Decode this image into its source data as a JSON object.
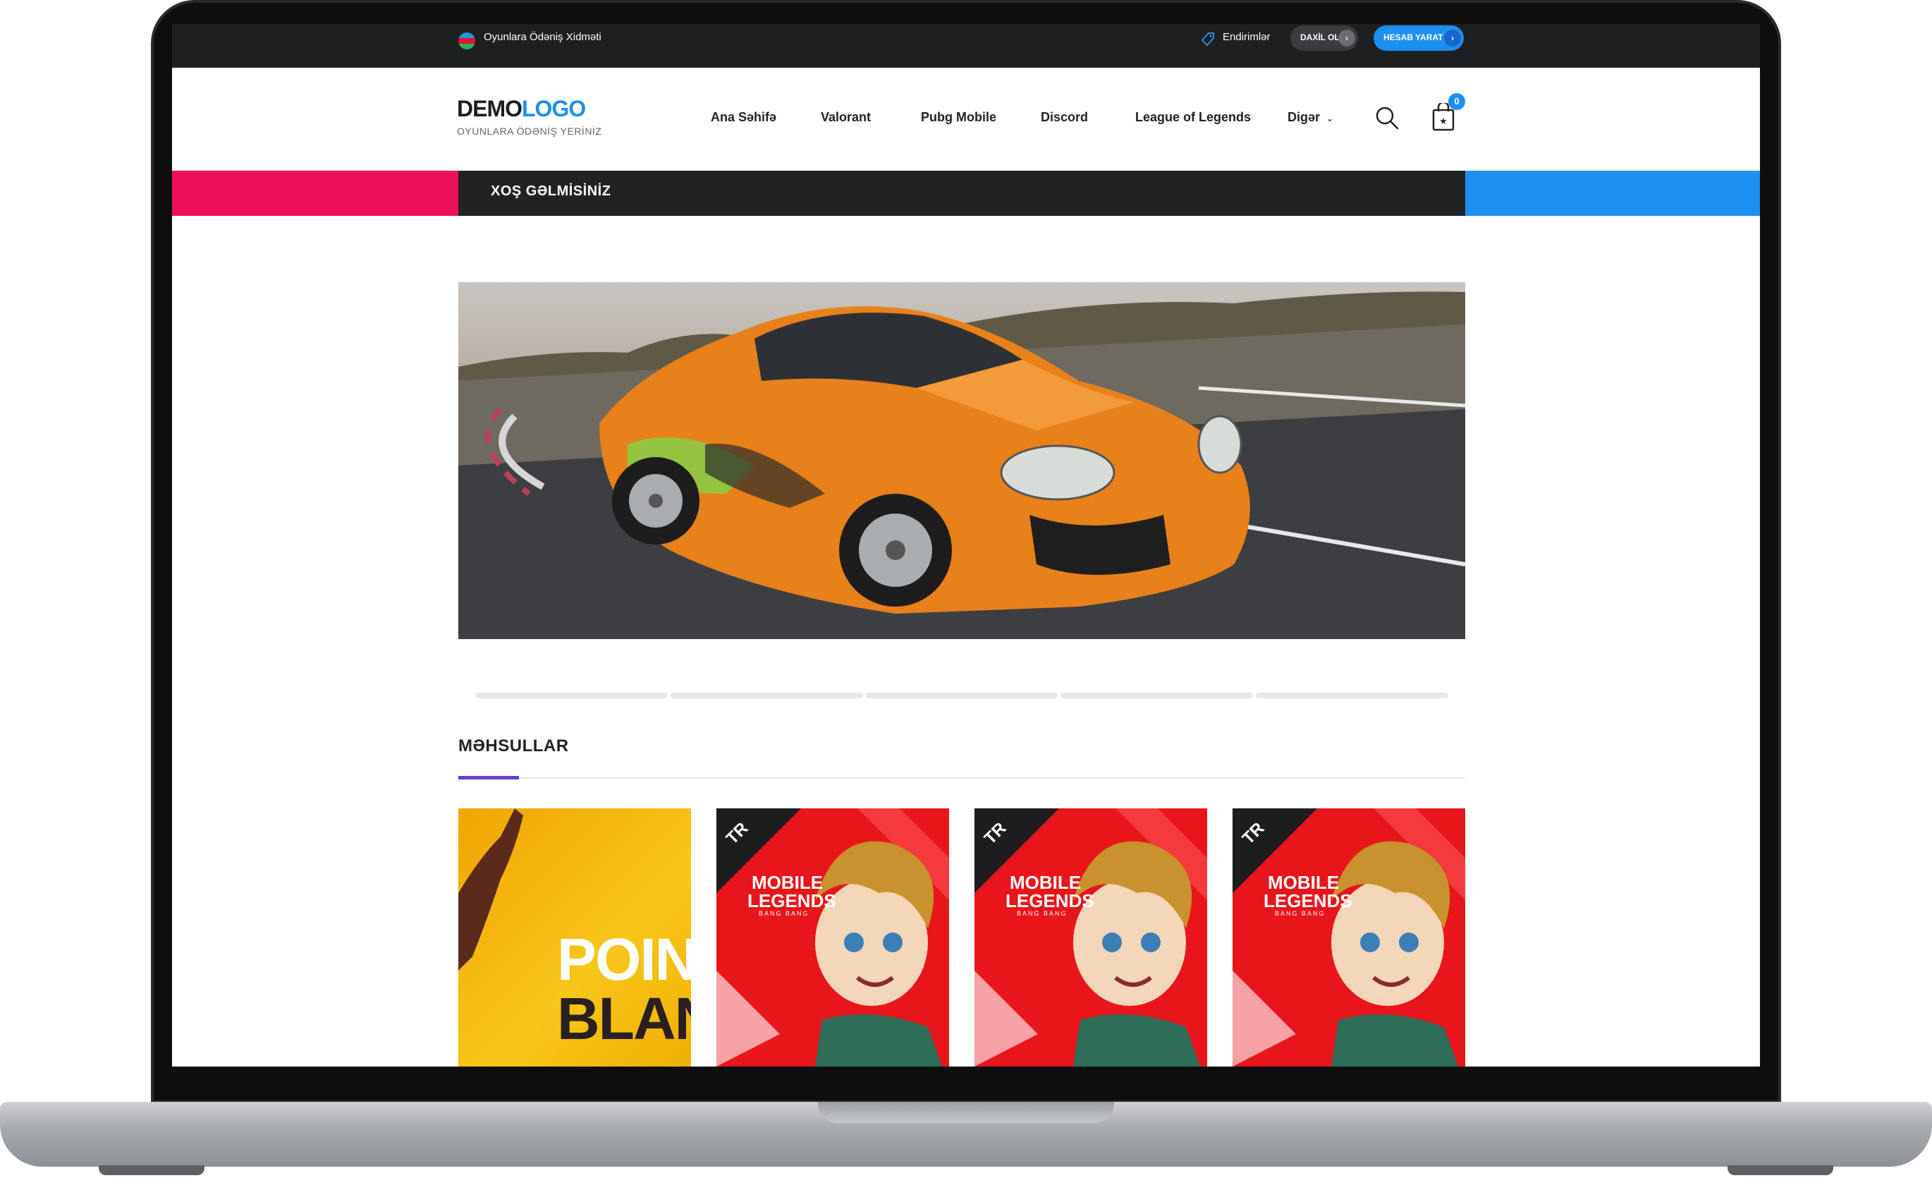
{
  "topbar": {
    "site_label": "Oyunlara Ödəniş Xidməti",
    "discounts": "Endirimlər",
    "login": "DAXİL OL",
    "register": "HESAB YARAT"
  },
  "header": {
    "logo_part1": "DEMO",
    "logo_part2": "LOGO",
    "logo_tagline": "OYUNLARA ÖDƏNİŞ YERİNİZ",
    "nav": [
      "Ana Səhifə",
      "Valorant",
      "Pubg Mobile",
      "Discord",
      "League of Legends",
      "Digər"
    ],
    "cart_count": "0"
  },
  "welcome": "XOŞ GƏLMİSİNİZ",
  "products": {
    "title": "MƏHSULLAR",
    "cards": [
      {
        "line1": "POINT",
        "line2": "BLAN"
      },
      {
        "badge": "TR",
        "line1": "MOBILE",
        "line2": "LEGENDS",
        "sub": "BANG BANG"
      },
      {
        "badge": "TR",
        "line1": "MOBILE",
        "line2": "LEGENDS",
        "sub": "BANG BANG"
      },
      {
        "badge": "TR",
        "line1": "MOBILE",
        "line2": "LEGENDS",
        "sub": "BANG BANG"
      }
    ]
  },
  "colors": {
    "accent_blue": "#1d8ff0",
    "accent_pink": "#ee0f5a",
    "title_accent": "#6a3cc8"
  }
}
